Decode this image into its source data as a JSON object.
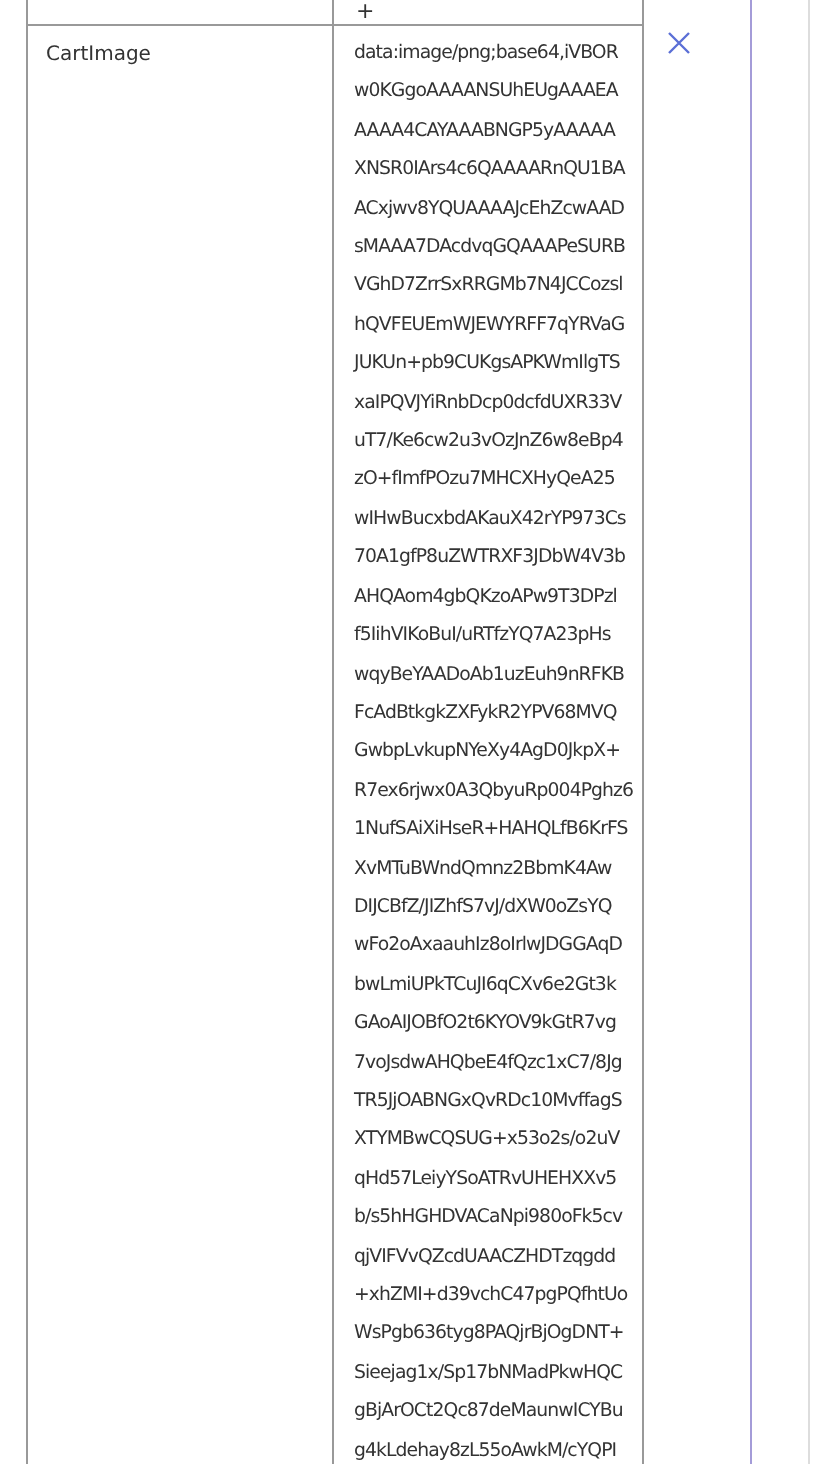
{
  "add_row": {
    "label": "+"
  },
  "rows": [
    {
      "key": "CartImage",
      "value_lines": [
        "data:image/png;base64,iVBOR",
        "w0KGgoAAAANSUhEUgAAAEA",
        "AAAA4CAYAAABNGP5yAAAAA",
        "XNSR0IArs4c6QAAAARnQU1BA",
        "ACxjwv8YQUAAAAJcEhZcwAAD",
        "sMAAA7DAcdvqGQAAAPeSURB",
        "VGhD7ZrrSxRRGMb7N4JCCozsl",
        "hQVFEUEmWJEWYRFF7qYRVaG",
        "JUKUn+pb9CUKgsAPKWmIlgTS",
        "xaIPQVJYiRnbDcp0dcfdUXR33V",
        "uT7/Ke6cw2u3vOzJnZ6w8eBp4",
        "zO+fImfPOzu7MHCXHyQeA25",
        "wIHwBucxbdAKauX42rYP973Cs",
        "70A1gfP8uZWTRXF3JDbW4V3b",
        "AHQAom4gbQKzoAPw9T3DPzl",
        "f5IihVIKoBuI/uRTfzYQ7A23pHs",
        "wqyBeYAADoAb1uzEuh9nRFKB",
        "FcAdBtkgkZXFykR2YPV68MVQ",
        "GwbpLvkupNYeXy4AgD0JkpX+",
        "R7ex6rjwx0A3QbyuRp004Pghz6",
        "1NufSAiXiHseR+HAHQLfB6KrFS",
        "XvMTuBWndQmnz2BbmK4Aw",
        "DIJCBfZ/JIZhfS7vJ/dXW0oZsYQ",
        "wFo2oAxaauhIz8oIrlwJDGGAqD",
        "bwLmiUPkTCuJI6qCXv6e2Gt3k",
        "GAoAIJOBfO2t6KYOV9kGtR7vg",
        "7voJsdwAHQbeE4fQzc1xC7/8Jg",
        "TR5JjOABNGxQvRDc10MvffagS",
        "XTYMBwCQSUG+x53o2s/o2uV",
        "qHd57LeiyYSoATRvUHEHXXv5",
        "b/s5hHGHDVACaNpi980oFk5cv",
        "qjVIFVvQZcdUAACZHDTzqgdd",
        "+xhZMI+d39vchC47pgPQfhtUo",
        "WsPgb636tyg8PAQjrBjOgDNT+",
        "Sieejag1x/Sp17bNMadPkwHQC",
        "gBjArOCt2Qc87deMaunwICYBu",
        "g4kLdehay8zL55oAwkM/cYQPI"
      ]
    }
  ]
}
